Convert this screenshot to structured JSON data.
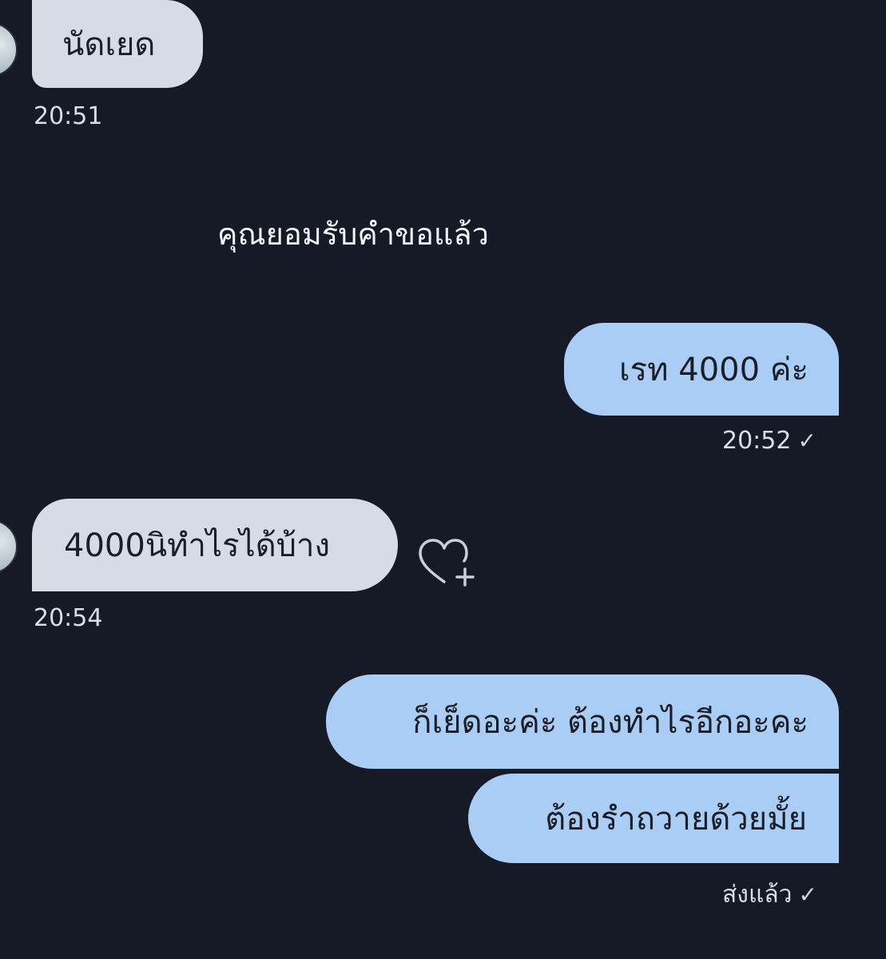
{
  "conversation": {
    "messages": [
      {
        "side": "incoming",
        "text": "นัดเยด",
        "time": "20:51"
      },
      {
        "side": "system",
        "text": "คุณยอมรับคำขอแล้ว"
      },
      {
        "side": "outgoing",
        "text": "เรท 4000 ค่ะ",
        "time": "20:52",
        "receipt": "✓"
      },
      {
        "side": "incoming",
        "text": "4000นิทำไรได้บ้าง",
        "time": "20:54"
      },
      {
        "side": "outgoing",
        "text": "ก็เย็ดอะค่ะ ต้องทำไรอีกอะคะ"
      },
      {
        "side": "outgoing",
        "text": "ต้องรำถวายด้วยมั้ย",
        "status": "ส่งแล้ว",
        "receipt": "✓"
      }
    ]
  },
  "icons": {
    "avatar": "contact-avatar",
    "reaction": "heart-plus-icon",
    "receipt": "check-icon"
  },
  "colors": {
    "background": "#161a27",
    "incoming_bubble": "#d7dbe5",
    "outgoing_bubble": "#a9cdf5"
  }
}
